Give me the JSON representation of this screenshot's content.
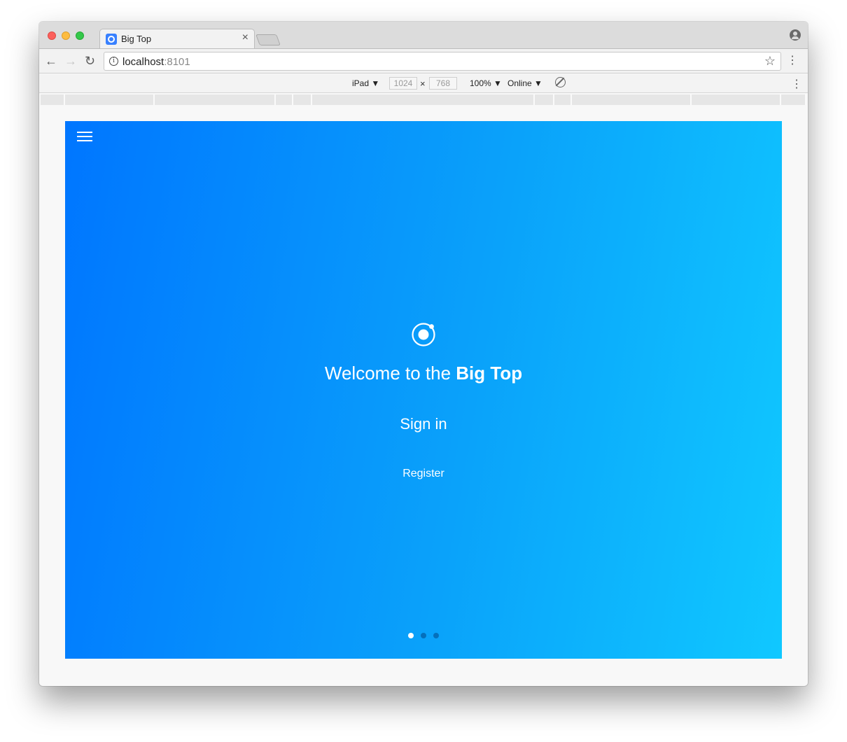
{
  "browser": {
    "tab_title": "Big Top",
    "tab_close": "×",
    "url_host": "localhost",
    "url_port": ":8101"
  },
  "device_toolbar": {
    "device": "iPad ▼",
    "width": "1024",
    "separator": "×",
    "height": "768",
    "zoom": "100% ▼",
    "network": "Online ▼"
  },
  "app": {
    "welcome_prefix": "Welcome to the ",
    "welcome_bold": "Big Top",
    "sign_in_label": "Sign in",
    "register_label": "Register",
    "slides": [
      {
        "active": true
      },
      {
        "active": false
      },
      {
        "active": false
      }
    ],
    "colors": {
      "gradient_start": "#0076ff",
      "gradient_end": "#10c8ff",
      "text": "#ffffff"
    }
  },
  "icons": {
    "favicon": "ionic-logo-icon",
    "logo": "ionic-logo-icon",
    "menu": "hamburger-menu-icon"
  }
}
